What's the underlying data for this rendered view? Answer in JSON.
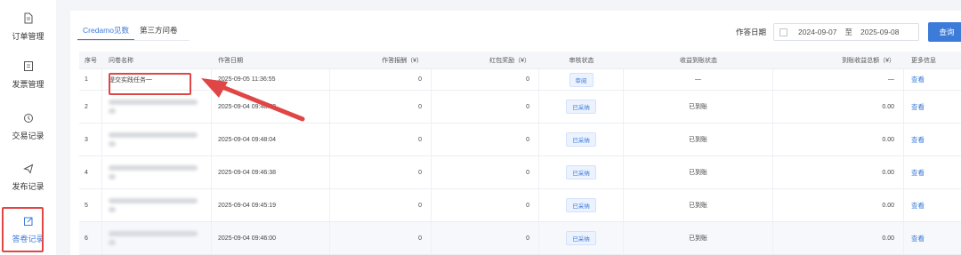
{
  "sidebar": {
    "items": [
      {
        "label": "订单管理",
        "icon": "document-icon"
      },
      {
        "label": "发票管理",
        "icon": "invoice-icon"
      },
      {
        "label": "交易记录",
        "icon": "transaction-icon"
      },
      {
        "label": "发布记录",
        "icon": "send-icon"
      },
      {
        "label": "答卷记录",
        "icon": "edit-icon"
      }
    ],
    "active_index": 4
  },
  "tabs": [
    "Credamo见数",
    "第三方问卷"
  ],
  "filter": {
    "label": "作答日期",
    "start": "2024-09-07",
    "separator": "至",
    "end": "2025-09-08",
    "search_label": "查询"
  },
  "table": {
    "headers": [
      "序号",
      "问卷名称",
      "作答日期",
      "作答报酬（¥）",
      "红包奖励（¥）",
      "审核状态",
      "收益到账状态",
      "到账收益总额（¥）",
      "更多信息"
    ],
    "rows": [
      {
        "no": "1",
        "name": "提交实践任务一",
        "date": "2025-09-05 11:36:55",
        "reward": "0",
        "red": "0",
        "audit": "审阅",
        "income": "—",
        "amount": "—",
        "more": "查看"
      },
      {
        "no": "2",
        "name": "",
        "date": "2025-09-04 09:48:52",
        "reward": "0",
        "red": "0",
        "audit": "已采纳",
        "income": "已到账",
        "amount": "0.00",
        "more": "查看"
      },
      {
        "no": "3",
        "name": "",
        "date": "2025-09-04 09:48:04",
        "reward": "0",
        "red": "0",
        "audit": "已采纳",
        "income": "已到账",
        "amount": "0.00",
        "more": "查看"
      },
      {
        "no": "4",
        "name": "",
        "date": "2025-09-04 09:46:38",
        "reward": "0",
        "red": "0",
        "audit": "已采纳",
        "income": "已到账",
        "amount": "0.00",
        "more": "查看"
      },
      {
        "no": "5",
        "name": "",
        "date": "2025-09-04 09:45:19",
        "reward": "0",
        "red": "0",
        "audit": "已采纳",
        "income": "已到账",
        "amount": "0.00",
        "more": "查看"
      },
      {
        "no": "6",
        "name": "",
        "date": "2025-09-04 09:46:00",
        "reward": "0",
        "red": "0",
        "audit": "已采纳",
        "income": "已到账",
        "amount": "0.00",
        "more": "查看"
      }
    ]
  },
  "colors": {
    "accent": "#3d7bd9",
    "annotation": "#e04646"
  }
}
